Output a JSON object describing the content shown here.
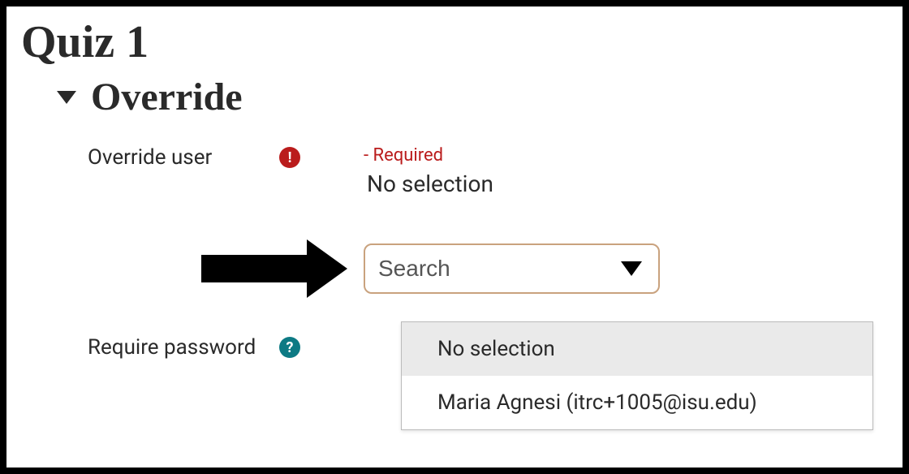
{
  "page": {
    "title": "Quiz 1"
  },
  "section": {
    "title": "Override"
  },
  "fields": {
    "override_user": {
      "label": "Override user",
      "required_text": "- Required",
      "current_value": "No selection"
    },
    "search": {
      "placeholder": "Search"
    },
    "require_password": {
      "label": "Require password"
    }
  },
  "dropdown": {
    "options": [
      {
        "label": "No selection"
      },
      {
        "label": "Maria Agnesi (itrc+1005@isu.edu)"
      }
    ]
  }
}
